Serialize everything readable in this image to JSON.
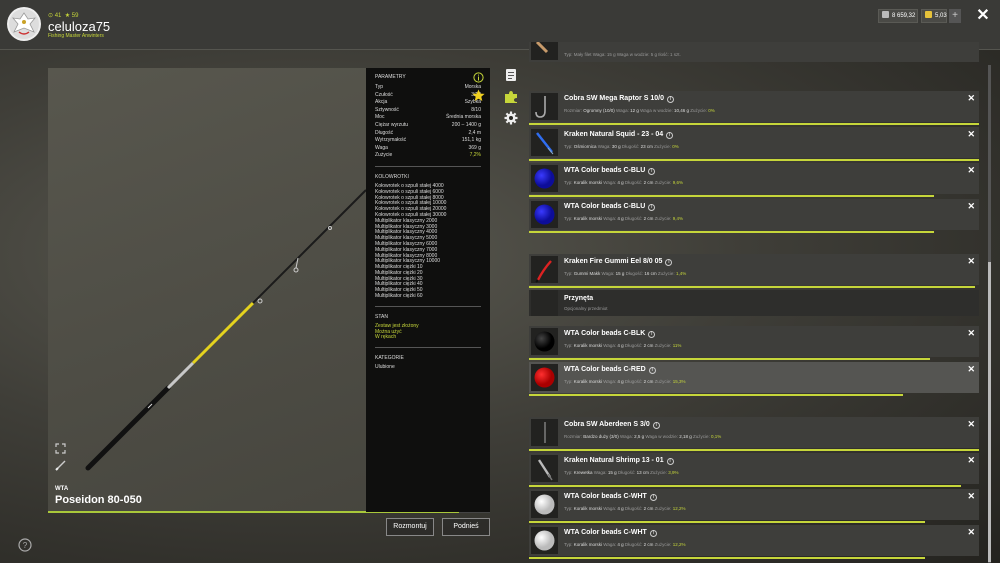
{
  "user": {
    "level": "⊙ 41",
    "stars": "★ 59",
    "name": "celuloza75",
    "club": "Fishing Master Anwinters"
  },
  "currency": {
    "silver": "8 659,32",
    "gold": "5,03"
  },
  "rod": {
    "brand": "WTA",
    "name": "Poseidon 80-050"
  },
  "specs": {
    "heading": "PARAMETRY",
    "rows": [
      {
        "k": "Typ",
        "v": "Morska"
      },
      {
        "k": "Czułość",
        "v": "3/10"
      },
      {
        "k": "Akcja",
        "v": "Szybka"
      },
      {
        "k": "Sztywność",
        "v": "8/10"
      },
      {
        "k": "Moc",
        "v": "Średnia morska"
      },
      {
        "k": "Ciężar wyrzutu",
        "v": "200 – 1400 g"
      },
      {
        "k": "Długość",
        "v": "2,4 m"
      },
      {
        "k": "Wytrzymałość",
        "v": "151,1 kg"
      },
      {
        "k": "Waga",
        "v": "369 g"
      },
      {
        "k": "Zużycie",
        "v": "7,2%"
      }
    ],
    "compat_heading": "KOLOWROTKI",
    "compat": [
      "Kołowrotek o szpuli stałej 4000",
      "Kołowrotek o szpuli stałej 6000",
      "Kołowrotek o szpuli stałej 8000",
      "Kołowrotek o szpuli stałej 10000",
      "Kołowrotek o szpuli stałej 20000",
      "Kołowrotek o szpuli stałej 30000",
      "Multiplikator klasyczny 2000",
      "Multiplikator klasyczny 3000",
      "Multiplikator klasyczny 4000",
      "Multiplikator klasyczny 5000",
      "Multiplikator klasyczny 6000",
      "Multiplikator klasyczny 7000",
      "Multiplikator klasyczny 8000",
      "Multiplikator klasyczny 10000",
      "Multiplikator ciężki 10",
      "Multiplikator ciężki 20",
      "Multiplikator ciężki 30",
      "Multiplikator ciężki 40",
      "Multiplikator ciężki 50",
      "Multiplikator ciężki 60"
    ],
    "state_heading": "STAN",
    "state": [
      "Zestaw jest złożony",
      "Można użyć",
      "W rękach"
    ],
    "category_heading": "KATEGORIE",
    "category": "Ulubione"
  },
  "buttons": {
    "disassemble": "Rozmontuj",
    "pickup": "Podnieś"
  },
  "top_item_meta": "Typ: Mały filet  Waga: 15 g  Waga w wodzie: 5 g  Ilość: 1 szt.",
  "items": [
    {
      "title": "Cobra SW Mega Raptor S 10/0",
      "meta": [
        "Rozmiar: ",
        "Ogromny (10/0)",
        "  Waga: ",
        "12 g",
        "  Waga w wodzie: ",
        "10,46 g",
        "  Zużycie: ",
        "0%"
      ],
      "thumb": "hook",
      "bar": 1.0
    },
    {
      "title": "Kraken Natural Squid - 23 - 04",
      "meta": [
        "Typ: ",
        "Ośmiornica",
        "  Waga: ",
        "30 g",
        "  Długość: ",
        "23 cm",
        "  Zużycie: ",
        "0%"
      ],
      "thumb": "squid",
      "bar": 1.0
    },
    {
      "title": "WTA Color beads C-BLU",
      "meta": [
        "Typ: ",
        "Koralik morski",
        "  Waga: ",
        "4 g",
        "  Długość: ",
        "2 cm",
        "  Zużycie: ",
        "9,6%"
      ],
      "thumb": "blue",
      "bar": 0.9
    },
    {
      "title": "WTA Color beads C-BLU",
      "meta": [
        "Typ: ",
        "Koralik morski",
        "  Waga: ",
        "4 g",
        "  Długość: ",
        "2 cm",
        "  Zużycie: ",
        "9,4%"
      ],
      "thumb": "blue",
      "bar": 0.9
    },
    {
      "title": "Kraken Fire Gummi Eel 8/0 05",
      "meta": [
        "Typ: ",
        "Gummi Makk",
        "  Waga: ",
        "15 g",
        "  Długość: ",
        "16 cm",
        "  Zużycie: ",
        "1,4%"
      ],
      "thumb": "eel",
      "bar": 0.99
    },
    {
      "title": "WTA Color beads C-BLK",
      "meta": [
        "Typ: ",
        "Koralik morski",
        "  Waga: ",
        "4 g",
        "  Długość: ",
        "2 cm",
        "  Zużycie: ",
        "11%"
      ],
      "thumb": "black",
      "bar": 0.89
    },
    {
      "title": "WTA Color beads C-RED",
      "meta": [
        "Typ: ",
        "Koralik morski",
        "  Waga: ",
        "4 g",
        "  Długość: ",
        "2 cm",
        "  Zużycie: ",
        "15,3%"
      ],
      "thumb": "red",
      "bar": 0.83
    },
    {
      "title": "Cobra SW Aberdeen S 3/0",
      "meta": [
        "Rozmiar: ",
        "Bardzo duży (3/0)",
        "  Waga: ",
        "2,5 g",
        "  Waga w wodzie: ",
        "2,18 g",
        "  Zużycie: ",
        "0,1%"
      ],
      "thumb": "thin",
      "bar": 1.0
    },
    {
      "title": "Kraken Natural Shrimp 13 - 01",
      "meta": [
        "Typ: ",
        "Krewetka",
        "  Waga: ",
        "15 g",
        "  Długość: ",
        "13 cm",
        "  Zużycie: ",
        "3,9%"
      ],
      "thumb": "shrimp",
      "bar": 0.96
    },
    {
      "title": "WTA Color beads C-WHT",
      "meta": [
        "Typ: ",
        "Koralik morski",
        "  Waga: ",
        "4 g",
        "  Długość: ",
        "2 cm",
        "  Zużycie: ",
        "12,2%"
      ],
      "thumb": "white",
      "bar": 0.88
    },
    {
      "title": "WTA Color beads C-WHT",
      "meta": [
        "Typ: ",
        "Koralik morski",
        "  Waga: ",
        "4 g",
        "  Długość: ",
        "2 cm",
        "  Zużycie: ",
        "12,2%"
      ],
      "thumb": "white",
      "bar": 0.88
    }
  ],
  "empty_slot": {
    "title": "Przynęta",
    "sub": "Opcjonalny przedmiot"
  },
  "rod_wear": 0.93,
  "colors": {
    "accent": "#c6d63a"
  }
}
